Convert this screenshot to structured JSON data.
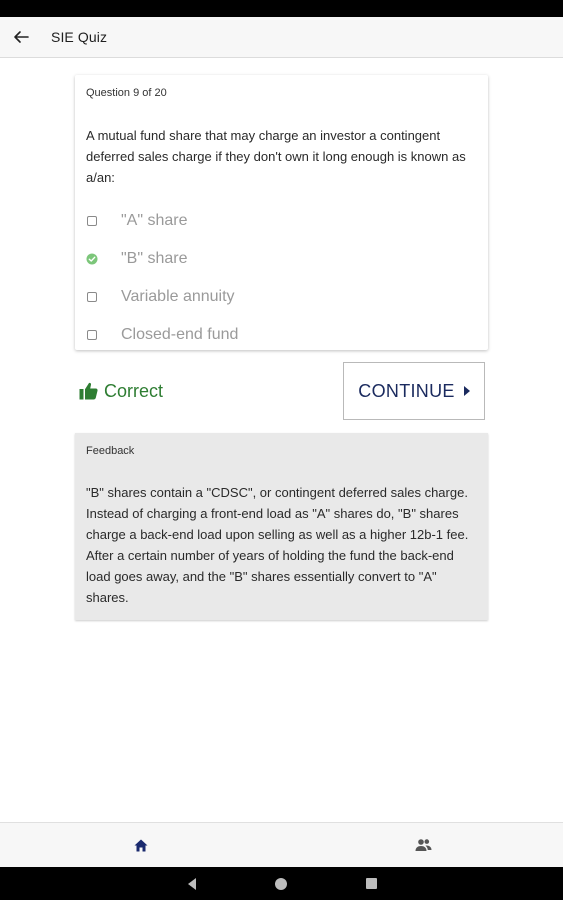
{
  "app_bar": {
    "title": "SIE Quiz"
  },
  "question": {
    "counter": "Question 9 of 20",
    "text": "A mutual fund share that may charge an investor a contingent deferred sales charge if they don't own it long enough is known as a/an:",
    "options": [
      {
        "label": "\"A\" share",
        "state": "unchecked"
      },
      {
        "label": "\"B\" share",
        "state": "correct"
      },
      {
        "label": "Variable annuity",
        "state": "unchecked"
      },
      {
        "label": "Closed-end fund",
        "state": "unchecked"
      }
    ]
  },
  "result": {
    "label": "Correct",
    "icon": "thumbs-up-icon",
    "color": "#2e7d32"
  },
  "continue_button": {
    "label": "CONTINUE",
    "icon": "chevron-right-icon"
  },
  "feedback": {
    "title": "Feedback",
    "text": "\"B\" shares contain a \"CDSC\", or contingent deferred sales charge. Instead of charging a front-end load as \"A\" shares do, \"B\" shares charge a back-end load upon selling as well as a higher 12b-1 fee. After a certain number of years of holding the fund the back-end load goes away, and the \"B\" shares essentially convert to \"A\" shares."
  },
  "bottom_nav": {
    "items": [
      {
        "icon": "home-icon",
        "active": true
      },
      {
        "icon": "people-icon",
        "active": false
      }
    ]
  },
  "colors": {
    "accent": "#1a2a5e",
    "correct": "#2e7d32",
    "check": "#7cc67a"
  }
}
